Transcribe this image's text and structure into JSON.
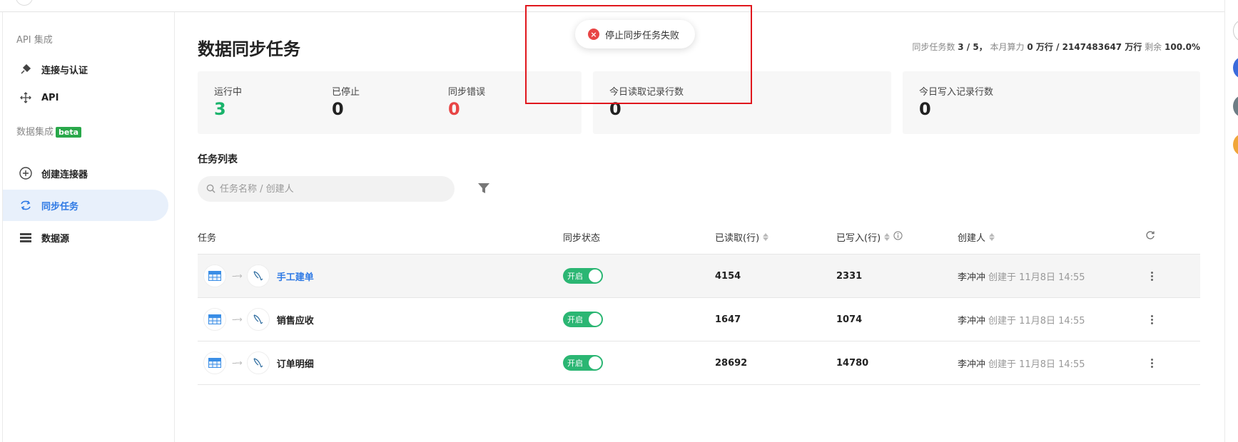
{
  "sidebar": {
    "section_api": "API 集成",
    "items_api": [
      {
        "label": "连接与认证",
        "icon": "plug-icon"
      },
      {
        "label": "API",
        "icon": "move-arrows-icon"
      }
    ],
    "section_data": "数据集成",
    "beta_badge": "beta",
    "items_data": [
      {
        "label": "创建连接器",
        "icon": "plus-circle-icon"
      },
      {
        "label": "同步任务",
        "icon": "sync-icon",
        "active": true
      },
      {
        "label": "数据源",
        "icon": "list-icon"
      }
    ]
  },
  "page": {
    "title": "数据同步任务",
    "summary": {
      "tasks_label": "同步任务数",
      "tasks_value": "3 / 5",
      "sep": "，",
      "compute_label": "本月算力",
      "compute_value": "0 万行 / 2147483647 万行",
      "remaining_label": "剩余",
      "remaining_value": "100.0%"
    }
  },
  "stats": {
    "running": {
      "label": "运行中",
      "value": "3",
      "color": "#19b36b"
    },
    "stopped": {
      "label": "已停止",
      "value": "0"
    },
    "error": {
      "label": "同步错误",
      "value": "0",
      "color": "#e84545"
    },
    "read_today": {
      "label": "今日读取记录行数",
      "value": "0"
    },
    "write_today": {
      "label": "今日写入记录行数",
      "value": "0"
    }
  },
  "task_list": {
    "title": "任务列表",
    "search_placeholder": "任务名称 / 创建人",
    "columns": {
      "task": "任务",
      "status": "同步状态",
      "read": "已读取(行)",
      "written": "已写入(行)",
      "creator": "创建人"
    },
    "rows": [
      {
        "name": "手工建单",
        "status": "开启",
        "read": "4154",
        "written": "2331",
        "creator": "李冲冲",
        "created": "创建于 11月8日 14:55"
      },
      {
        "name": "销售应收",
        "status": "开启",
        "read": "1647",
        "written": "1074",
        "creator": "李冲冲",
        "created": "创建于 11月8日 14:55"
      },
      {
        "name": "订单明细",
        "status": "开启",
        "read": "28692",
        "written": "14780",
        "creator": "李冲冲",
        "created": "创建于 11月8日 14:55"
      }
    ]
  },
  "toast": {
    "message": "停止同步任务失败",
    "icon": "error-icon"
  },
  "colors": {
    "accent": "#2f7ae5",
    "success": "#2bb673",
    "error": "#e84545",
    "highlight_box": "#e0171d"
  }
}
